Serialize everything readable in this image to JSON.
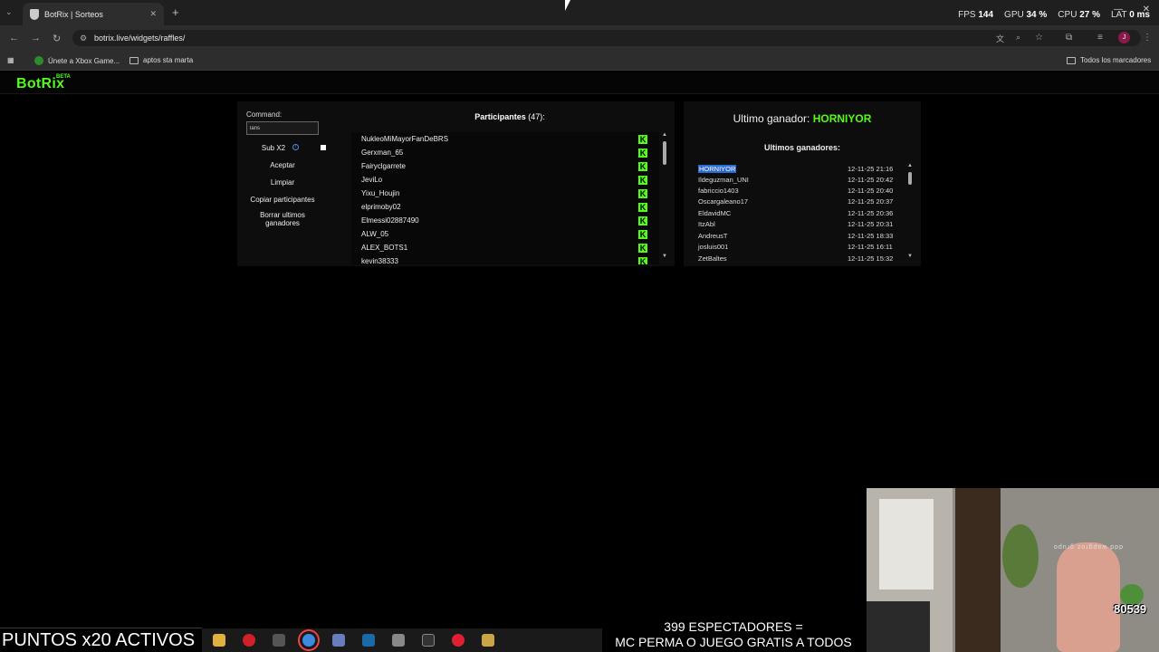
{
  "browser": {
    "tab_title": "BotRix | Sorteos",
    "url": "botrix.live/widgets/raffles/",
    "bookmarks": [
      "Únete a Xbox Game...",
      "aptos sta marta"
    ],
    "all_bookmarks": "Todos los marcadores",
    "avatar_letter": "J"
  },
  "overlay_stats": {
    "fps_label": "FPS",
    "fps_value": "144",
    "gpu_label": "GPU",
    "gpu_value": "34 %",
    "cpu_label": "CPU",
    "cpu_value": "27 %",
    "lat_label": "LAT",
    "lat_value": "0 ms"
  },
  "site": {
    "logo": "BotRix",
    "beta": "BETA"
  },
  "controls": {
    "command_label": "Command:",
    "command_value": "laris",
    "subx2_label": "Sub X2",
    "accept": "Aceptar",
    "clear": "Limpiar",
    "copy": "Copiar participantes",
    "delete_winners": "Borrar ultimos ganadores"
  },
  "participants": {
    "title": "Participantes",
    "count": "(47):",
    "names": [
      "NukleoMiMayorFanDeBRS",
      "Gerxman_65",
      "Fairyclgarrete",
      "JeviLo",
      "Yixu_Houjin",
      "elprimoby02",
      "Elmessi02887490",
      "ALW_05",
      "ALEX_BOTS1",
      "kevin38333"
    ]
  },
  "winner": {
    "label": "Ultimo ganador:",
    "name": "HORNIYOR",
    "list_title": "Ultimos ganadores:",
    "rows": [
      {
        "name": "HORNIYOR",
        "date": "12-11-25 21:16"
      },
      {
        "name": "Ildeguzman_UNI",
        "date": "12-11-25 20:42"
      },
      {
        "name": "fabriccio1403",
        "date": "12-11-25 20:40"
      },
      {
        "name": "Oscargaleano17",
        "date": "12-11-25 20:37"
      },
      {
        "name": "EldavidMC",
        "date": "12-11-25 20:36"
      },
      {
        "name": "ItzAbl",
        "date": "12-11-25 20:31"
      },
      {
        "name": "AndreusT",
        "date": "12-11-25 18:33"
      },
      {
        "name": "josluis001",
        "date": "12-11-25 16:11"
      },
      {
        "name": "ZetBaltes",
        "date": "12-11-25 15:32"
      }
    ]
  },
  "stream": {
    "puntos": "PUNTOS x20 ACTIVOS",
    "viewers_line1": "399 ESPECTADORES =",
    "viewers_line2": "MC PERMA O JUEGO GRATIS A TODOS",
    "cam_count": "80539",
    "cam_brand": "ddd wapgroz grupo"
  },
  "colors": {
    "accent": "#53fc18",
    "highlight": "#2b6ad0"
  }
}
